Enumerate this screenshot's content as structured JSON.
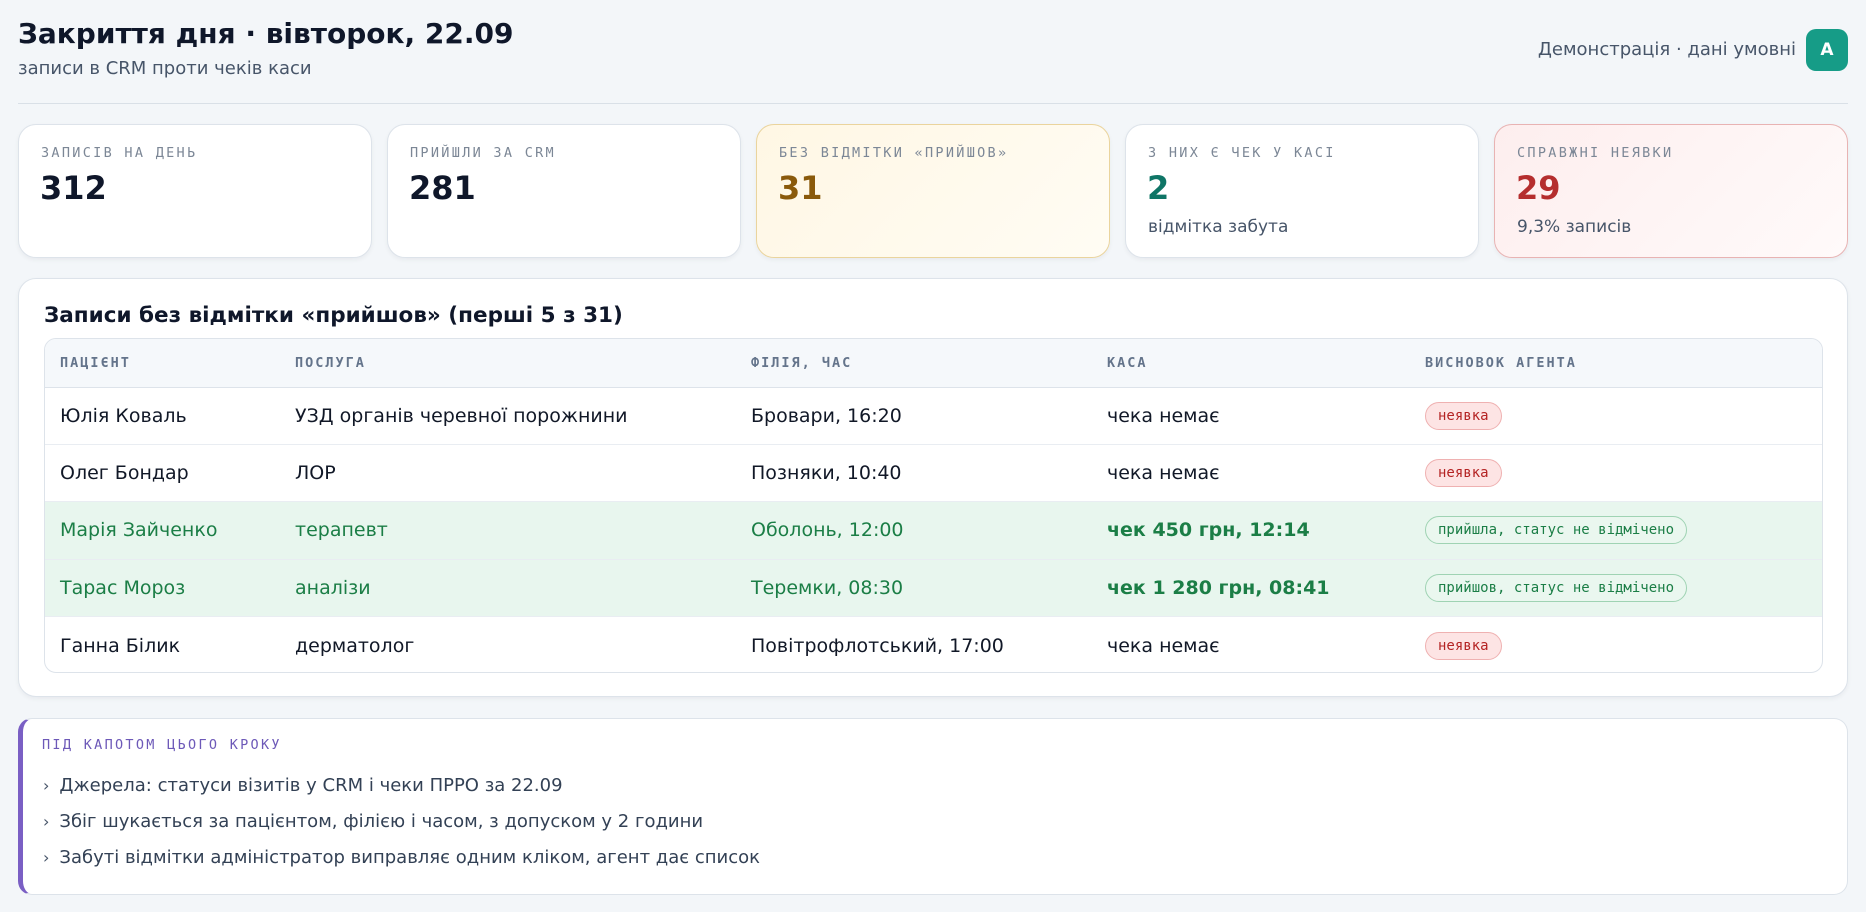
{
  "header": {
    "title": "Закриття дня · вівторок, 22.09",
    "subtitle": "записи в CRM проти чеків каси",
    "demo_label": "Демонстрація · дані умовні",
    "avatar_letter": "A"
  },
  "kpis": [
    {
      "label": "ЗАПИСІВ НА ДЕНЬ",
      "value": "312",
      "note": ""
    },
    {
      "label": "ПРИЙШЛИ ЗА CRM",
      "value": "281",
      "note": ""
    },
    {
      "label": "БЕЗ ВІДМІТКИ «ПРИЙШОВ»",
      "value": "31",
      "note": ""
    },
    {
      "label": "З НИХ Є ЧЕК У КАСІ",
      "value": "2",
      "note": "відмітка забута"
    },
    {
      "label": "СПРАВЖНІ НЕЯВКИ",
      "value": "29",
      "note": "9,3% записів"
    }
  ],
  "table": {
    "title": "Записи без відмітки «прийшов» (перші 5 з 31)",
    "columns": [
      "ПАЦІЄНТ",
      "ПОСЛУГА",
      "ФІЛІЯ, ЧАС",
      "КАСА",
      "ВИСНОВОК АГЕНТА"
    ],
    "rows": [
      {
        "patient": "Юлія Коваль",
        "service": "УЗД органів черевної порожнини",
        "branch_time": "Бровари, 16:20",
        "cash": "чека немає",
        "verdict": "неявка"
      },
      {
        "patient": "Олег Бондар",
        "service": "ЛОР",
        "branch_time": "Позняки, 10:40",
        "cash": "чека немає",
        "verdict": "неявка"
      },
      {
        "patient": "Марія Зайченко",
        "service": "терапевт",
        "branch_time": "Оболонь, 12:00",
        "cash": "чек 450 грн, 12:14",
        "verdict": "прийшла, статус не відмічено"
      },
      {
        "patient": "Тарас Мороз",
        "service": "аналізи",
        "branch_time": "Теремки, 08:30",
        "cash": "чек 1 280 грн, 08:41",
        "verdict": "прийшов, статус не відмічено"
      },
      {
        "patient": "Ганна Білик",
        "service": "дерматолог",
        "branch_time": "Повітрофлотський, 17:00",
        "cash": "чека немає",
        "verdict": "неявка"
      }
    ]
  },
  "notes": {
    "label": "ПІД КАПОТОМ ЦЬОГО КРОКУ",
    "items": [
      "Джерела: статуси візитів у CRM і чеки ПРРО за 22.09",
      "Збіг шукається за пацієнтом, філією і часом, з допуском у 2 години",
      "Забуті відмітки адміністратор виправляє одним кліком, агент дає список"
    ]
  },
  "colors": {
    "accent_teal": "#169c87",
    "warning": "#8a5a0b",
    "danger": "#b52e2e",
    "success": "#1b7e46",
    "notes_accent": "#7a5fc4"
  }
}
